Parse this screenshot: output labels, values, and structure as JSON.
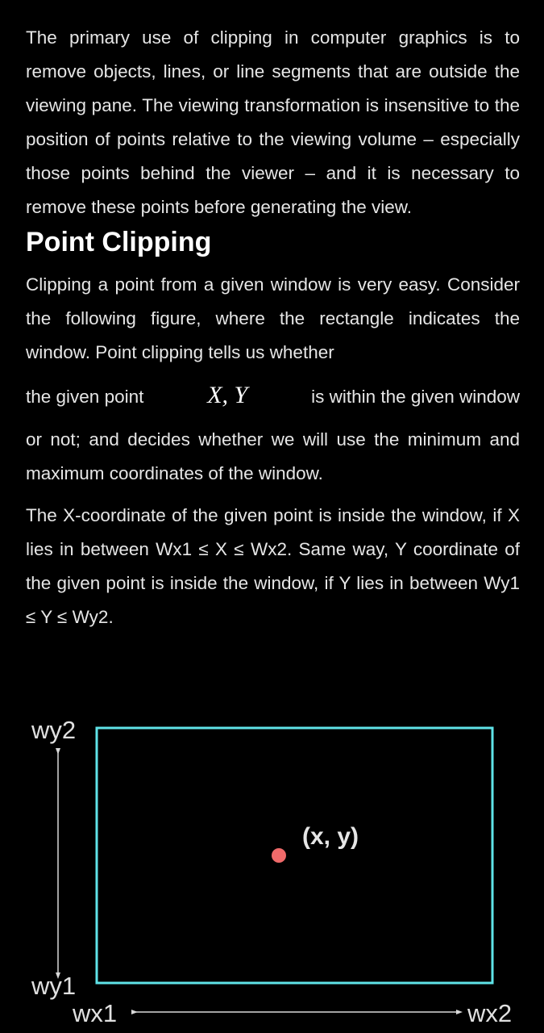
{
  "intro": {
    "text": "The primary use of clipping in computer graphics is to remove objects, lines, or line segments that are outside the viewing pane. The viewing transformation is insensitive to the position of points relative to the viewing volume – especially those points behind the viewer – and it is necessary to remove these points before generating the view."
  },
  "section": {
    "heading": "Point Clipping",
    "para2_start": "Clipping a point from a given window is very easy. Consider the following figure, where the rectangle indicates the window. Point clipping tells us whether",
    "para2_math_before": "the given point",
    "para2_math": "X, Y",
    "para2_math_after": "is within the given window",
    "para2_end": "or not; and decides whether we will use the minimum and maximum coordinates of the window.",
    "para3": "The X-coordinate of the given point is inside the window, if X lies in between Wx1 ≤ X ≤ Wx2. Same way, Y coordinate of the given point is inside the window, if Y lies in between Wy1 ≤ Y ≤ Wy2."
  },
  "figure": {
    "label_wy2": "wy2",
    "label_wy1": "wy1",
    "label_wx1": "wx1",
    "label_wx2": "wx2",
    "point_label": "(x, y)",
    "window_color": "#5fe3e8",
    "point_color": "#f06a6a",
    "arrow_color": "#d8d8d8"
  }
}
